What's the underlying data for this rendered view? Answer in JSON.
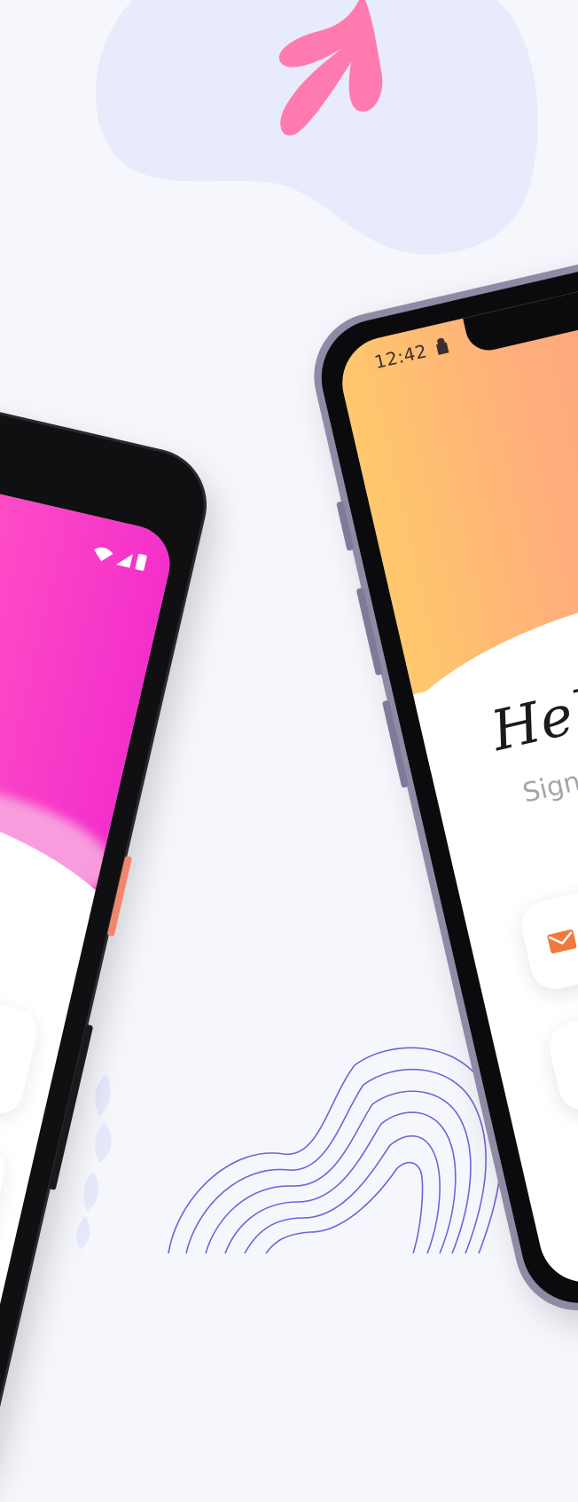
{
  "status_bar": {
    "time": "12:42"
  },
  "login": {
    "greeting": "Hello",
    "subtitle": "Sign in"
  },
  "colors": {
    "background": "#f6f7fc",
    "blob": "#e8ebfb",
    "leaf": "#ff7aae",
    "contour_lines": "#6b66dc",
    "left_gradient_start": "#ff7fb8",
    "left_gradient_end": "#f42fcb",
    "right_gradient_start": "#ffc86c",
    "right_gradient_end": "#ff9588",
    "mail_icon": "#f07a3c"
  },
  "icons": {
    "status": [
      "wifi-icon",
      "signal-icon",
      "battery-icon",
      "lock-icon"
    ],
    "field": "mail-icon"
  }
}
